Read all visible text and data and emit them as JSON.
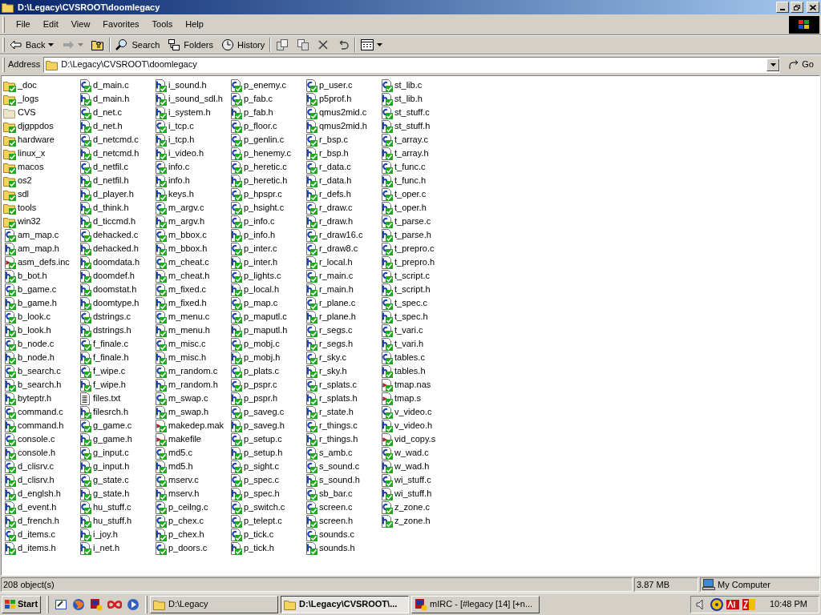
{
  "window": {
    "title": "D:\\Legacy\\CVSROOT\\doomlegacy"
  },
  "menu": [
    "File",
    "Edit",
    "View",
    "Favorites",
    "Tools",
    "Help"
  ],
  "toolbar": {
    "back": "Back",
    "search": "Search",
    "folders": "Folders",
    "history": "History"
  },
  "address": {
    "label": "Address",
    "value": "D:\\Legacy\\CVSROOT\\doomlegacy",
    "go": "Go"
  },
  "files": [
    {
      "name": "_doc",
      "kind": "folder",
      "tracked": true
    },
    {
      "name": "_logs",
      "kind": "folder",
      "tracked": true
    },
    {
      "name": "CVS",
      "kind": "folder",
      "tracked": false
    },
    {
      "name": "djgppdos",
      "kind": "folder",
      "tracked": true
    },
    {
      "name": "hardware",
      "kind": "folder",
      "tracked": true
    },
    {
      "name": "linux_x",
      "kind": "folder",
      "tracked": true
    },
    {
      "name": "macos",
      "kind": "folder",
      "tracked": true
    },
    {
      "name": "os2",
      "kind": "folder",
      "tracked": true
    },
    {
      "name": "sdl",
      "kind": "folder",
      "tracked": true
    },
    {
      "name": "tools",
      "kind": "folder",
      "tracked": true
    },
    {
      "name": "win32",
      "kind": "folder",
      "tracked": true
    },
    {
      "name": "am_map.c",
      "kind": "c",
      "tracked": true
    },
    {
      "name": "am_map.h",
      "kind": "h",
      "tracked": true
    },
    {
      "name": "asm_defs.inc",
      "kind": "script",
      "tracked": true
    },
    {
      "name": "b_bot.h",
      "kind": "h",
      "tracked": true
    },
    {
      "name": "b_game.c",
      "kind": "c",
      "tracked": true
    },
    {
      "name": "b_game.h",
      "kind": "h",
      "tracked": true
    },
    {
      "name": "b_look.c",
      "kind": "c",
      "tracked": true
    },
    {
      "name": "b_look.h",
      "kind": "h",
      "tracked": true
    },
    {
      "name": "b_node.c",
      "kind": "c",
      "tracked": true
    },
    {
      "name": "b_node.h",
      "kind": "h",
      "tracked": true
    },
    {
      "name": "b_search.c",
      "kind": "c",
      "tracked": true
    },
    {
      "name": "b_search.h",
      "kind": "h",
      "tracked": true
    },
    {
      "name": "byteptr.h",
      "kind": "h",
      "tracked": true
    },
    {
      "name": "command.c",
      "kind": "c",
      "tracked": true
    },
    {
      "name": "command.h",
      "kind": "h",
      "tracked": true
    },
    {
      "name": "console.c",
      "kind": "c",
      "tracked": true
    },
    {
      "name": "console.h",
      "kind": "h",
      "tracked": true
    },
    {
      "name": "d_clisrv.c",
      "kind": "c",
      "tracked": true
    },
    {
      "name": "d_clisrv.h",
      "kind": "h",
      "tracked": true
    },
    {
      "name": "d_englsh.h",
      "kind": "h",
      "tracked": true
    },
    {
      "name": "d_event.h",
      "kind": "h",
      "tracked": true
    },
    {
      "name": "d_french.h",
      "kind": "h",
      "tracked": true
    },
    {
      "name": "d_items.c",
      "kind": "c",
      "tracked": true
    },
    {
      "name": "d_items.h",
      "kind": "h",
      "tracked": true
    },
    {
      "name": "d_main.c",
      "kind": "c",
      "tracked": true
    },
    {
      "name": "d_main.h",
      "kind": "h",
      "tracked": true
    },
    {
      "name": "d_net.c",
      "kind": "c",
      "tracked": true
    },
    {
      "name": "d_net.h",
      "kind": "h",
      "tracked": true
    },
    {
      "name": "d_netcmd.c",
      "kind": "c",
      "tracked": true
    },
    {
      "name": "d_netcmd.h",
      "kind": "h",
      "tracked": true
    },
    {
      "name": "d_netfil.c",
      "kind": "c",
      "tracked": true
    },
    {
      "name": "d_netfil.h",
      "kind": "h",
      "tracked": true
    },
    {
      "name": "d_player.h",
      "kind": "h",
      "tracked": true
    },
    {
      "name": "d_think.h",
      "kind": "h",
      "tracked": true
    },
    {
      "name": "d_ticcmd.h",
      "kind": "h",
      "tracked": true
    },
    {
      "name": "dehacked.c",
      "kind": "c",
      "tracked": true
    },
    {
      "name": "dehacked.h",
      "kind": "h",
      "tracked": true
    },
    {
      "name": "doomdata.h",
      "kind": "h",
      "tracked": true
    },
    {
      "name": "doomdef.h",
      "kind": "h",
      "tracked": true
    },
    {
      "name": "doomstat.h",
      "kind": "h",
      "tracked": true
    },
    {
      "name": "doomtype.h",
      "kind": "h",
      "tracked": true
    },
    {
      "name": "dstrings.c",
      "kind": "c",
      "tracked": true
    },
    {
      "name": "dstrings.h",
      "kind": "h",
      "tracked": true
    },
    {
      "name": "f_finale.c",
      "kind": "c",
      "tracked": true
    },
    {
      "name": "f_finale.h",
      "kind": "h",
      "tracked": true
    },
    {
      "name": "f_wipe.c",
      "kind": "c",
      "tracked": true
    },
    {
      "name": "f_wipe.h",
      "kind": "h",
      "tracked": true
    },
    {
      "name": "files.txt",
      "kind": "text",
      "tracked": false
    },
    {
      "name": "filesrch.h",
      "kind": "h",
      "tracked": true
    },
    {
      "name": "g_game.c",
      "kind": "c",
      "tracked": true
    },
    {
      "name": "g_game.h",
      "kind": "h",
      "tracked": true
    },
    {
      "name": "g_input.c",
      "kind": "c",
      "tracked": true
    },
    {
      "name": "g_input.h",
      "kind": "h",
      "tracked": true
    },
    {
      "name": "g_state.c",
      "kind": "c",
      "tracked": true
    },
    {
      "name": "g_state.h",
      "kind": "h",
      "tracked": true
    },
    {
      "name": "hu_stuff.c",
      "kind": "c",
      "tracked": true
    },
    {
      "name": "hu_stuff.h",
      "kind": "h",
      "tracked": true
    },
    {
      "name": "i_joy.h",
      "kind": "h",
      "tracked": true
    },
    {
      "name": "i_net.h",
      "kind": "h",
      "tracked": true
    },
    {
      "name": "i_sound.h",
      "kind": "h",
      "tracked": true
    },
    {
      "name": "i_sound_sdl.h",
      "kind": "h",
      "tracked": true
    },
    {
      "name": "i_system.h",
      "kind": "h",
      "tracked": true
    },
    {
      "name": "i_tcp.c",
      "kind": "c",
      "tracked": true
    },
    {
      "name": "i_tcp.h",
      "kind": "h",
      "tracked": true
    },
    {
      "name": "i_video.h",
      "kind": "h",
      "tracked": true
    },
    {
      "name": "info.c",
      "kind": "c",
      "tracked": true
    },
    {
      "name": "info.h",
      "kind": "h",
      "tracked": true
    },
    {
      "name": "keys.h",
      "kind": "h",
      "tracked": true
    },
    {
      "name": "m_argv.c",
      "kind": "c",
      "tracked": true
    },
    {
      "name": "m_argv.h",
      "kind": "h",
      "tracked": true
    },
    {
      "name": "m_bbox.c",
      "kind": "c",
      "tracked": true
    },
    {
      "name": "m_bbox.h",
      "kind": "h",
      "tracked": true
    },
    {
      "name": "m_cheat.c",
      "kind": "c",
      "tracked": true
    },
    {
      "name": "m_cheat.h",
      "kind": "h",
      "tracked": true
    },
    {
      "name": "m_fixed.c",
      "kind": "c",
      "tracked": true
    },
    {
      "name": "m_fixed.h",
      "kind": "h",
      "tracked": true
    },
    {
      "name": "m_menu.c",
      "kind": "c",
      "tracked": true
    },
    {
      "name": "m_menu.h",
      "kind": "h",
      "tracked": true
    },
    {
      "name": "m_misc.c",
      "kind": "c",
      "tracked": true
    },
    {
      "name": "m_misc.h",
      "kind": "h",
      "tracked": true
    },
    {
      "name": "m_random.c",
      "kind": "c",
      "tracked": true
    },
    {
      "name": "m_random.h",
      "kind": "h",
      "tracked": true
    },
    {
      "name": "m_swap.c",
      "kind": "c",
      "tracked": true
    },
    {
      "name": "m_swap.h",
      "kind": "h",
      "tracked": true
    },
    {
      "name": "makedep.mak",
      "kind": "script",
      "tracked": true
    },
    {
      "name": "makefile",
      "kind": "script",
      "tracked": true
    },
    {
      "name": "md5.c",
      "kind": "c",
      "tracked": true
    },
    {
      "name": "md5.h",
      "kind": "h",
      "tracked": true
    },
    {
      "name": "mserv.c",
      "kind": "c",
      "tracked": true
    },
    {
      "name": "mserv.h",
      "kind": "h",
      "tracked": true
    },
    {
      "name": "p_ceilng.c",
      "kind": "c",
      "tracked": true
    },
    {
      "name": "p_chex.c",
      "kind": "c",
      "tracked": true
    },
    {
      "name": "p_chex.h",
      "kind": "h",
      "tracked": true
    },
    {
      "name": "p_doors.c",
      "kind": "c",
      "tracked": true
    },
    {
      "name": "p_enemy.c",
      "kind": "c",
      "tracked": true
    },
    {
      "name": "p_fab.c",
      "kind": "c",
      "tracked": true
    },
    {
      "name": "p_fab.h",
      "kind": "h",
      "tracked": true
    },
    {
      "name": "p_floor.c",
      "kind": "c",
      "tracked": true
    },
    {
      "name": "p_genlin.c",
      "kind": "c",
      "tracked": true
    },
    {
      "name": "p_henemy.c",
      "kind": "c",
      "tracked": true
    },
    {
      "name": "p_heretic.c",
      "kind": "c",
      "tracked": true
    },
    {
      "name": "p_heretic.h",
      "kind": "h",
      "tracked": true
    },
    {
      "name": "p_hpspr.c",
      "kind": "c",
      "tracked": true
    },
    {
      "name": "p_hsight.c",
      "kind": "c",
      "tracked": true
    },
    {
      "name": "p_info.c",
      "kind": "c",
      "tracked": true
    },
    {
      "name": "p_info.h",
      "kind": "h",
      "tracked": true
    },
    {
      "name": "p_inter.c",
      "kind": "c",
      "tracked": true
    },
    {
      "name": "p_inter.h",
      "kind": "h",
      "tracked": true
    },
    {
      "name": "p_lights.c",
      "kind": "c",
      "tracked": true
    },
    {
      "name": "p_local.h",
      "kind": "h",
      "tracked": true
    },
    {
      "name": "p_map.c",
      "kind": "c",
      "tracked": true
    },
    {
      "name": "p_maputl.c",
      "kind": "c",
      "tracked": true
    },
    {
      "name": "p_maputl.h",
      "kind": "h",
      "tracked": true
    },
    {
      "name": "p_mobj.c",
      "kind": "c",
      "tracked": true
    },
    {
      "name": "p_mobj.h",
      "kind": "h",
      "tracked": true
    },
    {
      "name": "p_plats.c",
      "kind": "c",
      "tracked": true
    },
    {
      "name": "p_pspr.c",
      "kind": "c",
      "tracked": true
    },
    {
      "name": "p_pspr.h",
      "kind": "h",
      "tracked": true
    },
    {
      "name": "p_saveg.c",
      "kind": "c",
      "tracked": true
    },
    {
      "name": "p_saveg.h",
      "kind": "h",
      "tracked": true
    },
    {
      "name": "p_setup.c",
      "kind": "c",
      "tracked": true
    },
    {
      "name": "p_setup.h",
      "kind": "h",
      "tracked": true
    },
    {
      "name": "p_sight.c",
      "kind": "c",
      "tracked": true
    },
    {
      "name": "p_spec.c",
      "kind": "c",
      "tracked": true
    },
    {
      "name": "p_spec.h",
      "kind": "h",
      "tracked": true
    },
    {
      "name": "p_switch.c",
      "kind": "c",
      "tracked": true
    },
    {
      "name": "p_telept.c",
      "kind": "c",
      "tracked": true
    },
    {
      "name": "p_tick.c",
      "kind": "c",
      "tracked": true
    },
    {
      "name": "p_tick.h",
      "kind": "h",
      "tracked": true
    },
    {
      "name": "p_user.c",
      "kind": "c",
      "tracked": true
    },
    {
      "name": "p5prof.h",
      "kind": "h",
      "tracked": true
    },
    {
      "name": "qmus2mid.c",
      "kind": "c",
      "tracked": true
    },
    {
      "name": "qmus2mid.h",
      "kind": "h",
      "tracked": true
    },
    {
      "name": "r_bsp.c",
      "kind": "c",
      "tracked": true
    },
    {
      "name": "r_bsp.h",
      "kind": "h",
      "tracked": true
    },
    {
      "name": "r_data.c",
      "kind": "c",
      "tracked": true
    },
    {
      "name": "r_data.h",
      "kind": "h",
      "tracked": true
    },
    {
      "name": "r_defs.h",
      "kind": "h",
      "tracked": true
    },
    {
      "name": "r_draw.c",
      "kind": "c",
      "tracked": true
    },
    {
      "name": "r_draw.h",
      "kind": "h",
      "tracked": true
    },
    {
      "name": "r_draw16.c",
      "kind": "c",
      "tracked": true
    },
    {
      "name": "r_draw8.c",
      "kind": "c",
      "tracked": true
    },
    {
      "name": "r_local.h",
      "kind": "h",
      "tracked": true
    },
    {
      "name": "r_main.c",
      "kind": "c",
      "tracked": true
    },
    {
      "name": "r_main.h",
      "kind": "h",
      "tracked": true
    },
    {
      "name": "r_plane.c",
      "kind": "c",
      "tracked": true
    },
    {
      "name": "r_plane.h",
      "kind": "h",
      "tracked": true
    },
    {
      "name": "r_segs.c",
      "kind": "c",
      "tracked": true
    },
    {
      "name": "r_segs.h",
      "kind": "h",
      "tracked": true
    },
    {
      "name": "r_sky.c",
      "kind": "c",
      "tracked": true
    },
    {
      "name": "r_sky.h",
      "kind": "h",
      "tracked": true
    },
    {
      "name": "r_splats.c",
      "kind": "c",
      "tracked": true
    },
    {
      "name": "r_splats.h",
      "kind": "h",
      "tracked": true
    },
    {
      "name": "r_state.h",
      "kind": "h",
      "tracked": true
    },
    {
      "name": "r_things.c",
      "kind": "c",
      "tracked": true
    },
    {
      "name": "r_things.h",
      "kind": "h",
      "tracked": true
    },
    {
      "name": "s_amb.c",
      "kind": "c",
      "tracked": true
    },
    {
      "name": "s_sound.c",
      "kind": "c",
      "tracked": true
    },
    {
      "name": "s_sound.h",
      "kind": "h",
      "tracked": true
    },
    {
      "name": "sb_bar.c",
      "kind": "c",
      "tracked": true
    },
    {
      "name": "screen.c",
      "kind": "c",
      "tracked": true
    },
    {
      "name": "screen.h",
      "kind": "h",
      "tracked": true
    },
    {
      "name": "sounds.c",
      "kind": "c",
      "tracked": true
    },
    {
      "name": "sounds.h",
      "kind": "h",
      "tracked": true
    },
    {
      "name": "st_lib.c",
      "kind": "c",
      "tracked": true
    },
    {
      "name": "st_lib.h",
      "kind": "h",
      "tracked": true
    },
    {
      "name": "st_stuff.c",
      "kind": "c",
      "tracked": true
    },
    {
      "name": "st_stuff.h",
      "kind": "h",
      "tracked": true
    },
    {
      "name": "t_array.c",
      "kind": "c",
      "tracked": true
    },
    {
      "name": "t_array.h",
      "kind": "h",
      "tracked": true
    },
    {
      "name": "t_func.c",
      "kind": "c",
      "tracked": true
    },
    {
      "name": "t_func.h",
      "kind": "h",
      "tracked": true
    },
    {
      "name": "t_oper.c",
      "kind": "c",
      "tracked": true
    },
    {
      "name": "t_oper.h",
      "kind": "h",
      "tracked": true
    },
    {
      "name": "t_parse.c",
      "kind": "c",
      "tracked": true
    },
    {
      "name": "t_parse.h",
      "kind": "h",
      "tracked": true
    },
    {
      "name": "t_prepro.c",
      "kind": "c",
      "tracked": true
    },
    {
      "name": "t_prepro.h",
      "kind": "h",
      "tracked": true
    },
    {
      "name": "t_script.c",
      "kind": "c",
      "tracked": true
    },
    {
      "name": "t_script.h",
      "kind": "h",
      "tracked": true
    },
    {
      "name": "t_spec.c",
      "kind": "c",
      "tracked": true
    },
    {
      "name": "t_spec.h",
      "kind": "h",
      "tracked": true
    },
    {
      "name": "t_vari.c",
      "kind": "c",
      "tracked": true
    },
    {
      "name": "t_vari.h",
      "kind": "h",
      "tracked": true
    },
    {
      "name": "tables.c",
      "kind": "c",
      "tracked": true
    },
    {
      "name": "tables.h",
      "kind": "h",
      "tracked": true
    },
    {
      "name": "tmap.nas",
      "kind": "script",
      "tracked": true
    },
    {
      "name": "tmap.s",
      "kind": "script",
      "tracked": true
    },
    {
      "name": "v_video.c",
      "kind": "c",
      "tracked": true
    },
    {
      "name": "v_video.h",
      "kind": "h",
      "tracked": true
    },
    {
      "name": "vid_copy.s",
      "kind": "script",
      "tracked": true
    },
    {
      "name": "w_wad.c",
      "kind": "c",
      "tracked": true
    },
    {
      "name": "w_wad.h",
      "kind": "h",
      "tracked": true
    },
    {
      "name": "wi_stuff.c",
      "kind": "c",
      "tracked": true
    },
    {
      "name": "wi_stuff.h",
      "kind": "h",
      "tracked": true
    },
    {
      "name": "z_zone.c",
      "kind": "c",
      "tracked": true
    },
    {
      "name": "z_zone.h",
      "kind": "h",
      "tracked": true
    }
  ],
  "status_bar": {
    "objects": "208 object(s)",
    "size": "3.87 MB",
    "zone": "My Computer"
  },
  "taskbar": {
    "start": "Start",
    "tasks": [
      {
        "label": "D:\\Legacy",
        "selected": false,
        "kind": "folder"
      },
      {
        "label": "D:\\Legacy\\CVSROOT\\...",
        "selected": true,
        "kind": "folder"
      },
      {
        "label": "mIRC - [#legacy [14] [+n...",
        "selected": false,
        "kind": "irc"
      }
    ],
    "clock": "10:48 PM"
  }
}
